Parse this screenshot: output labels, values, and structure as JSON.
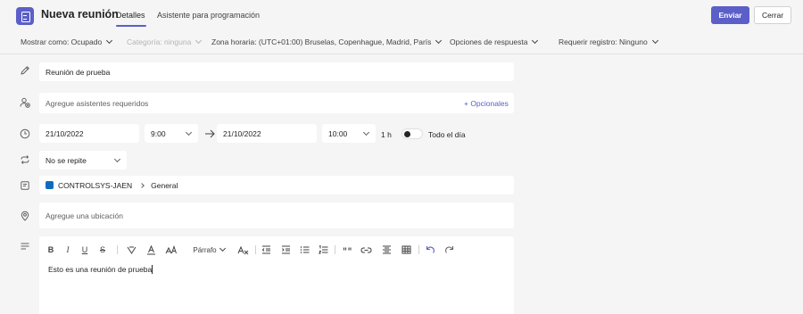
{
  "header": {
    "title": "Nueva reunión",
    "tabs": [
      {
        "label": "Detalles",
        "active": true
      },
      {
        "label": "Asistente para programación",
        "active": false
      }
    ],
    "send_label": "Enviar",
    "close_label": "Cerrar"
  },
  "options_bar": {
    "show_as": "Mostrar como: Ocupado",
    "category": "Categoría: ninguna",
    "timezone": "Zona horaria: (UTC+01:00) Bruselas, Copenhague, Madrid, París",
    "response_options": "Opciones de respuesta",
    "registration": "Requerir registro: Ninguno"
  },
  "form": {
    "title_value": "Reunión de prueba",
    "attendees_placeholder": "Agregue asistentes requeridos",
    "optional_link": "+ Opcionales",
    "start_date": "21/10/2022",
    "start_time": "9:00",
    "end_date": "21/10/2022",
    "end_time": "10:00",
    "duration": "1 h",
    "all_day_label": "Todo el día",
    "all_day_on": false,
    "recurrence": "No se repite",
    "channel_team": "CONTROLSYS-JAEN",
    "channel_name": "General",
    "location_placeholder": "Agregue una ubicación"
  },
  "editor": {
    "paragraph_label": "Párrafo",
    "body_text": "Esto es una reunión de prueba"
  },
  "colors": {
    "accent": "#5b5fc7",
    "channel_badge": "#0f6cbd"
  }
}
